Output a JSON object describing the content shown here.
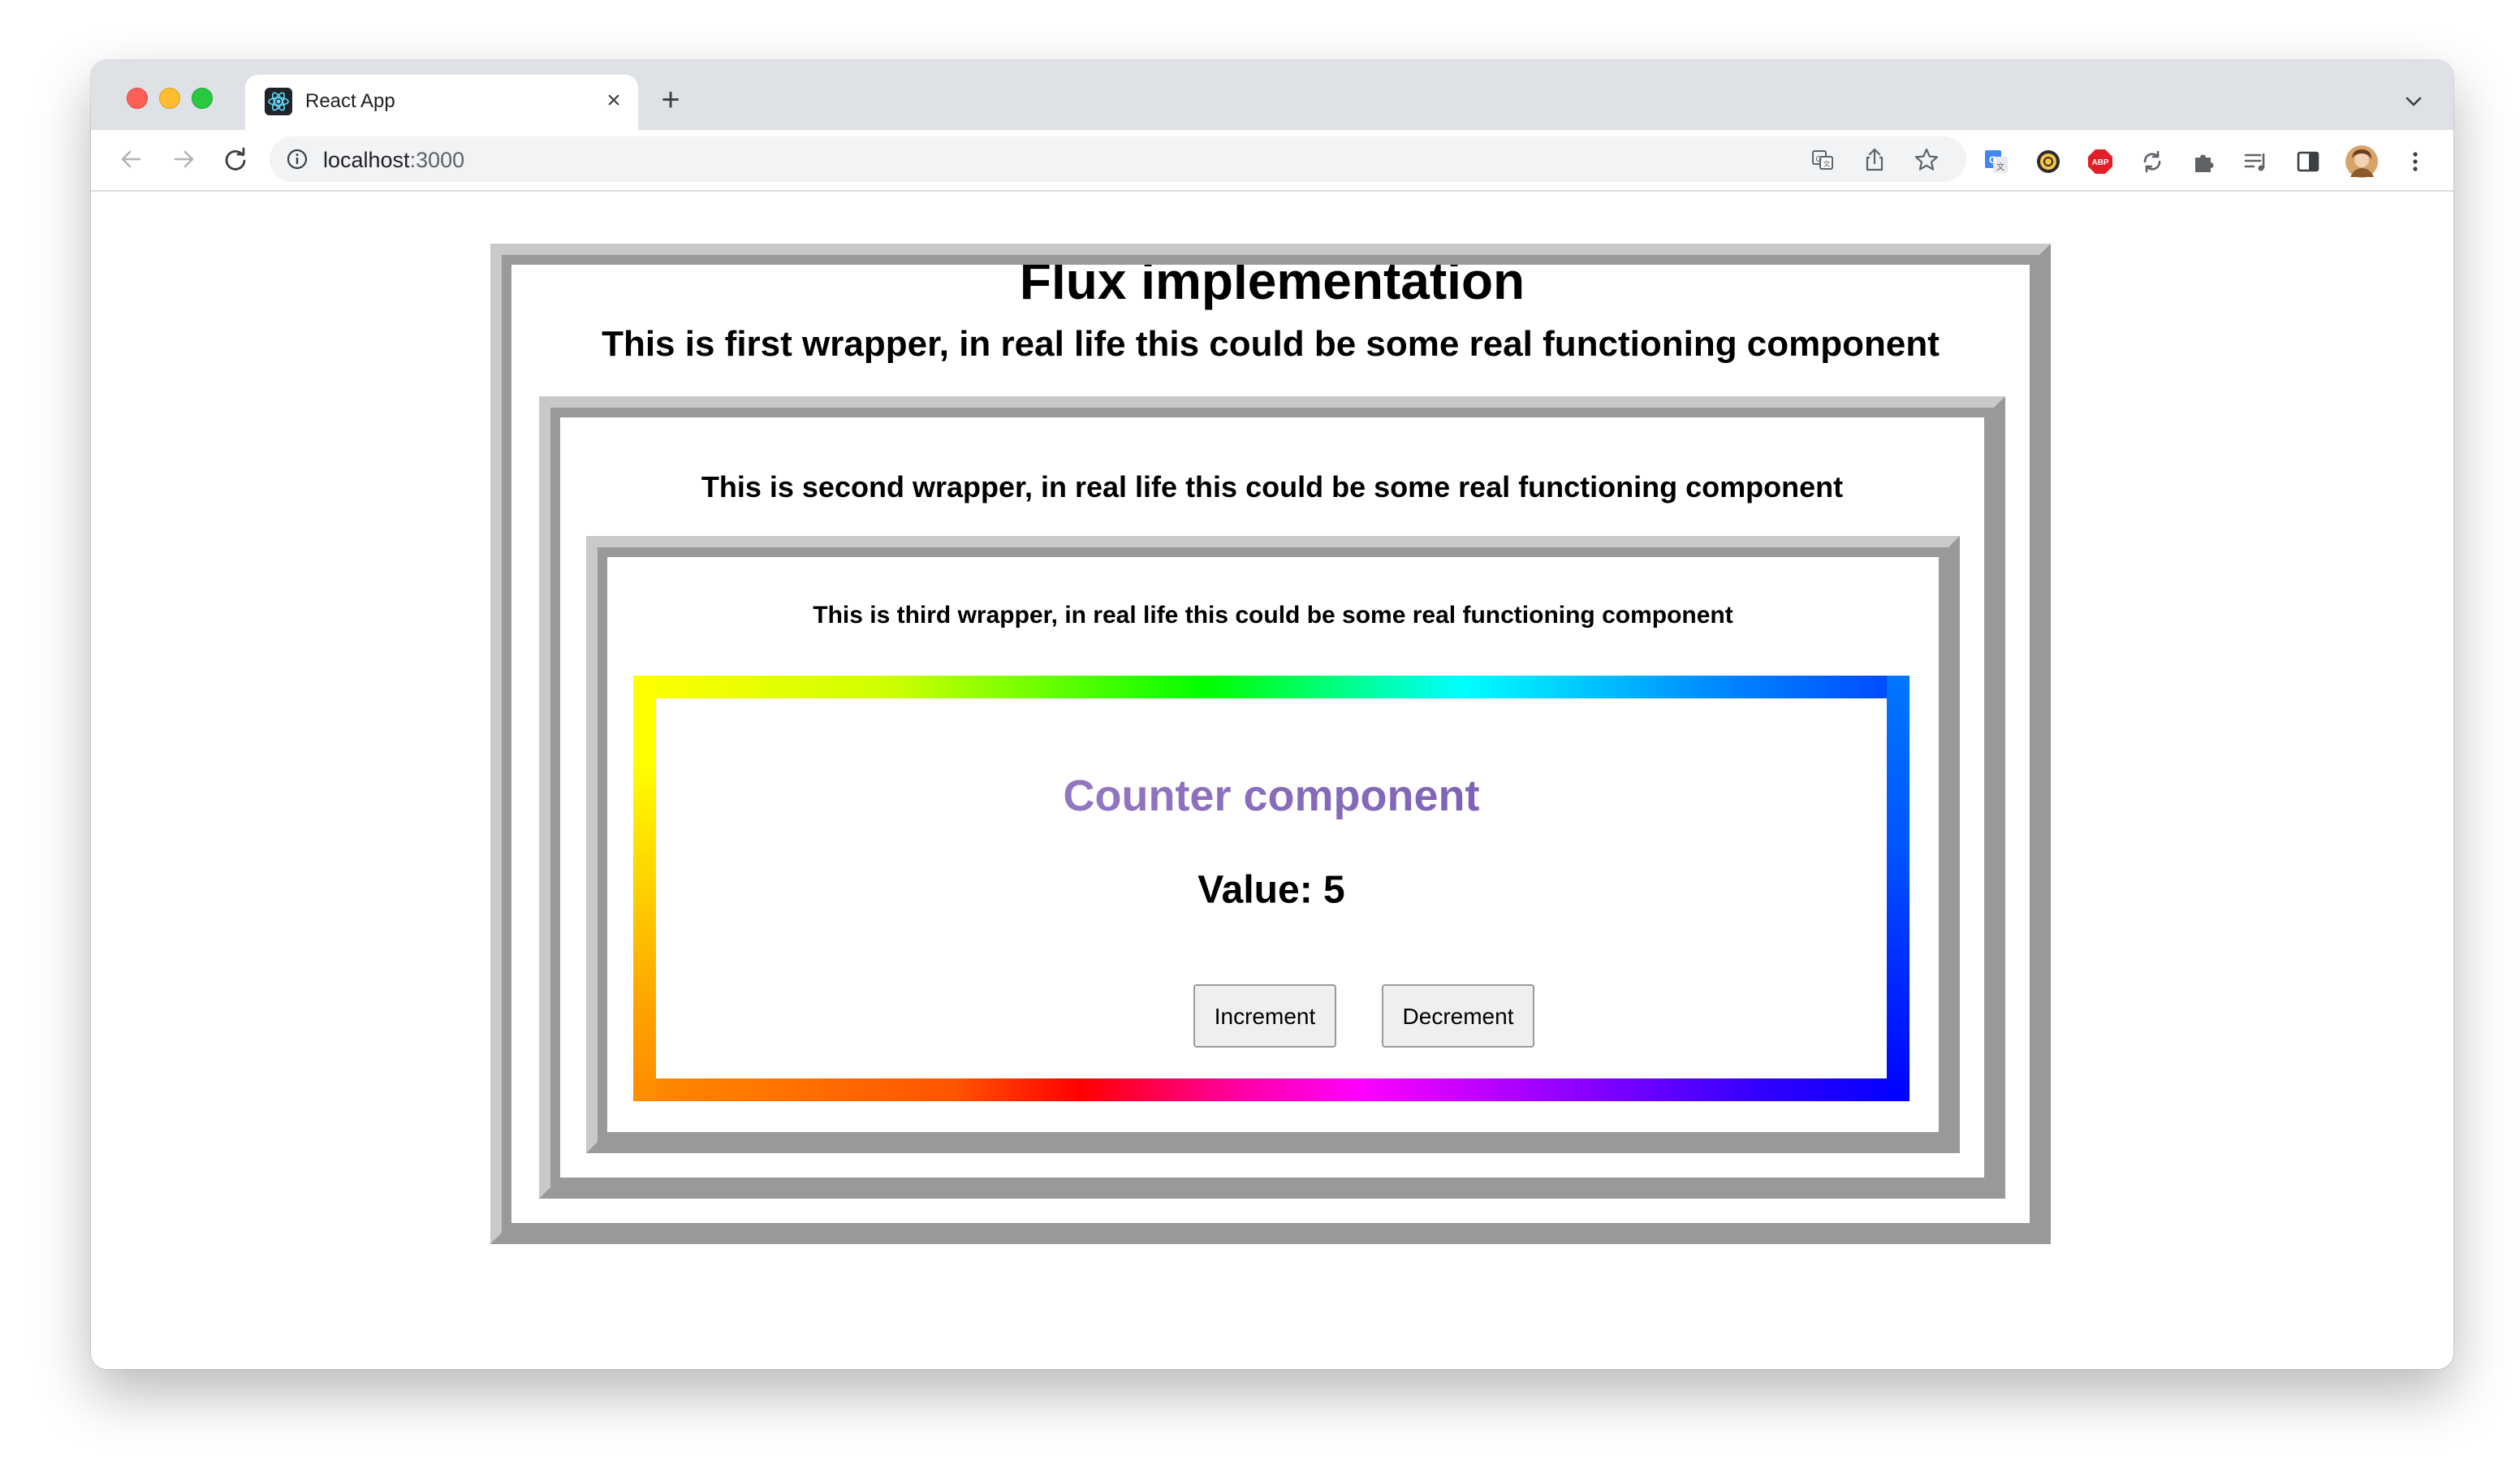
{
  "browser": {
    "tab_title": "React App",
    "tab_close": "×",
    "new_tab": "+",
    "url_host": "localhost",
    "url_port": ":3000"
  },
  "page": {
    "title": "Flux implementation",
    "first_wrapper": "This is first wrapper, in real life this could be some real functioning component",
    "second_wrapper": "This is second wrapper, in real life this could be some real functioning component",
    "third_wrapper": "This is third wrapper, in real life this could be some real functioning component",
    "counter": {
      "title": "Counter component",
      "value_label": "Value: 5",
      "increment_label": "Increment",
      "decrement_label": "Decrement"
    }
  },
  "colors": {
    "counter_title_gradient": [
      "#a78bd0",
      "#6a4ea8"
    ],
    "wrapper_border_light": "#c9c9c9",
    "wrapper_border_dark": "#999999"
  },
  "icons": {
    "tab_favicon": "react-icon",
    "toolbar": [
      "back-arrow-icon",
      "forward-arrow-icon",
      "reload-icon",
      "info-icon",
      "translate-icon",
      "share-icon",
      "star-icon",
      "google-translate-icon",
      "extension-coin-icon",
      "adblock-icon",
      "sync-icon",
      "puzzle-icon",
      "reading-list-icon",
      "side-panel-icon",
      "avatar",
      "more-vert-icon"
    ]
  }
}
